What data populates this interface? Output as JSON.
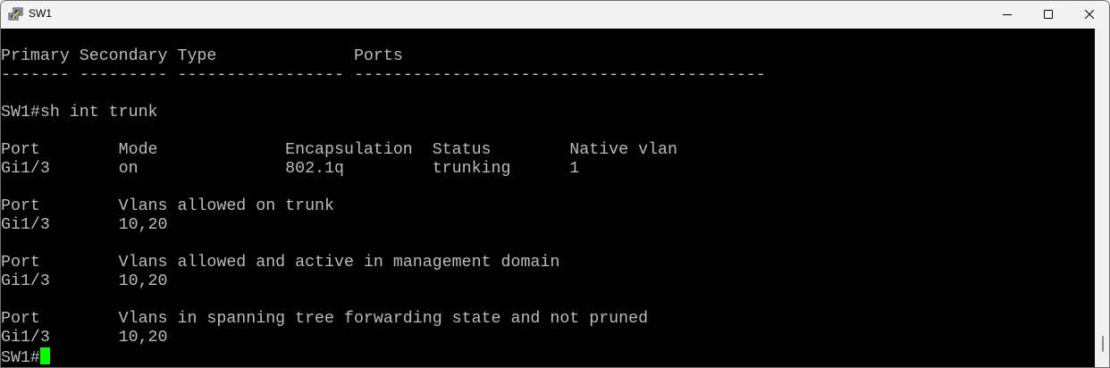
{
  "window": {
    "title": "SW1",
    "icon": "putty-icon"
  },
  "controls": {
    "minimize": "minimize-icon",
    "maximize": "maximize-icon",
    "close": "close-icon"
  },
  "terminal": {
    "lines": [
      "",
      "Primary Secondary Type              Ports",
      "------- --------- ----------------- ------------------------------------------",
      "",
      "SW1#sh int trunk",
      "",
      "Port        Mode             Encapsulation  Status        Native vlan",
      "Gi1/3       on               802.1q         trunking      1",
      "",
      "Port        Vlans allowed on trunk",
      "Gi1/3       10,20",
      "",
      "Port        Vlans allowed and active in management domain",
      "Gi1/3       10,20",
      "",
      "Port        Vlans in spanning tree forwarding state and not pruned",
      "Gi1/3       10,20"
    ],
    "prompt": "SW1#",
    "cursor_color": "#00ff00",
    "text_color": "#bbbbbb"
  }
}
